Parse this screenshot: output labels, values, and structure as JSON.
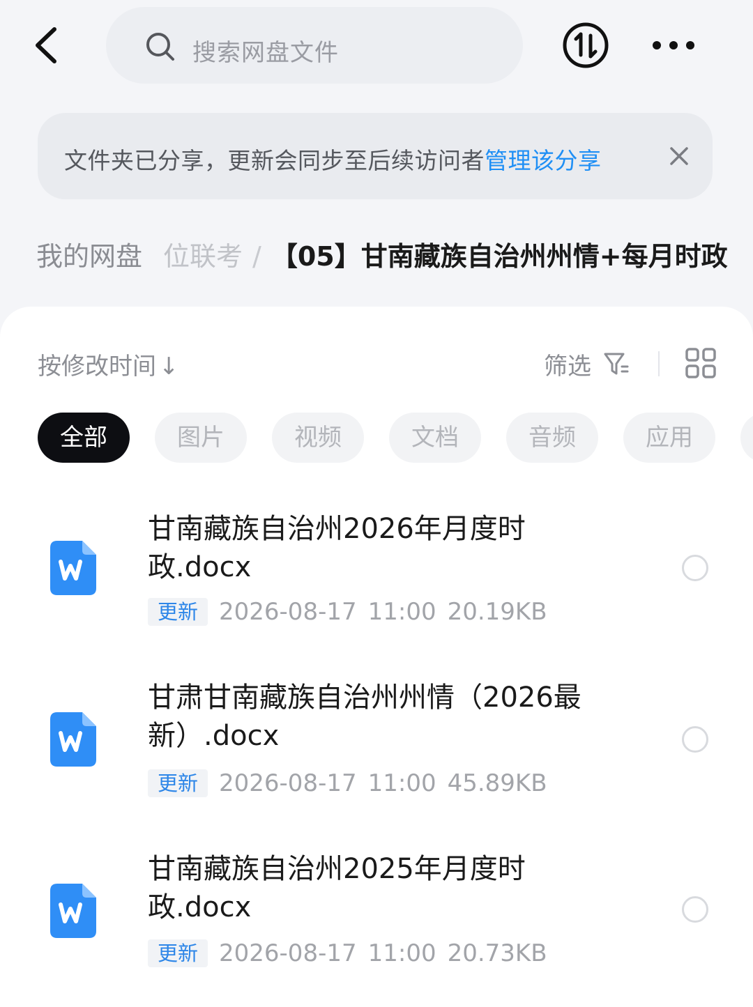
{
  "header": {
    "search_placeholder": "搜索网盘文件"
  },
  "banner": {
    "message": "文件夹已分享，更新会同步至后续访问者",
    "link": "管理该分享"
  },
  "breadcrumb": {
    "root": "我的网盘",
    "middle": "位联考",
    "separator": "/",
    "current": "【05】甘南藏族自治州州情+每月时政"
  },
  "toolbar": {
    "sort_label": "按修改时间",
    "sort_arrow": "↓",
    "filter_label": "筛选"
  },
  "chips": [
    {
      "label": "全部",
      "active": true
    },
    {
      "label": "图片",
      "active": false
    },
    {
      "label": "视频",
      "active": false
    },
    {
      "label": "文档",
      "active": false
    },
    {
      "label": "音频",
      "active": false
    },
    {
      "label": "应用",
      "active": false
    }
  ],
  "files": [
    {
      "name": "甘南藏族自治州2026年月度时政.docx",
      "tag": "更新",
      "date": "2026-08-17",
      "time": "11:00",
      "size": "20.19KB"
    },
    {
      "name": "甘肃甘南藏族自治州州情（2026最新）.docx",
      "tag": "更新",
      "date": "2026-08-17",
      "time": "11:00",
      "size": "45.89KB"
    },
    {
      "name": "甘南藏族自治州2025年月度时政.docx",
      "tag": "更新",
      "date": "2026-08-17",
      "time": "11:00",
      "size": "20.73KB"
    }
  ],
  "colors": {
    "accent_link": "#1f8ff5",
    "tag_text": "#2d86e8",
    "word_icon": "#2f8ef6",
    "active_chip": "#0d0e12"
  }
}
